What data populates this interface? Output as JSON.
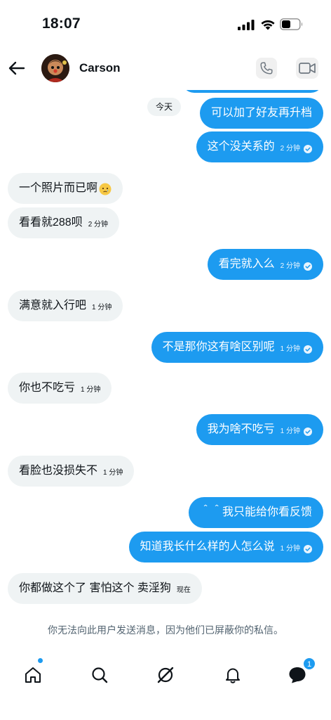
{
  "status_bar": {
    "time": "18:07"
  },
  "header": {
    "contact_name": "Carson"
  },
  "chat": {
    "date_chip": "今天",
    "messages": [
      {
        "dir": "out",
        "text": "可以加了好友再升档",
        "stamp": "",
        "read": false
      },
      {
        "dir": "out",
        "text": "这个没关系的",
        "stamp": "2 分钟",
        "read": true
      },
      {
        "dir": "in",
        "text": "一个照片而已啊",
        "stamp": "",
        "emoji": "crying-face-emoji"
      },
      {
        "dir": "in",
        "text": "看看就288呗",
        "stamp": "2 分钟"
      },
      {
        "dir": "out",
        "text": "看完就入么",
        "stamp": "2 分钟",
        "read": true
      },
      {
        "dir": "in",
        "text": "满意就入行吧",
        "stamp": "1 分钟"
      },
      {
        "dir": "out",
        "text": "不是那你这有啥区别呢",
        "stamp": "1 分钟",
        "read": true
      },
      {
        "dir": "in",
        "text": "你也不吃亏",
        "stamp": "1 分钟"
      },
      {
        "dir": "out",
        "text": "我为啥不吃亏",
        "stamp": "1 分钟",
        "read": true
      },
      {
        "dir": "in",
        "text": "看脸也没损失不",
        "stamp": "1 分钟"
      },
      {
        "dir": "out",
        "text": "＾＾我只能给你看反馈",
        "stamp": "",
        "read": false
      },
      {
        "dir": "out",
        "text": "知道我长什么样的人怎么说",
        "stamp": "1 分钟",
        "read": true
      },
      {
        "dir": "in",
        "text": "你都做这个了 害怕这个 卖淫狗",
        "stamp": "现在"
      }
    ]
  },
  "notice": "你无法向此用户发送消息，因为他们已屏蔽你的私信。",
  "bottom_nav": {
    "items": [
      "home-icon",
      "search-icon",
      "grok-icon",
      "notifications-icon",
      "messages-icon"
    ],
    "messages_badge": "1"
  },
  "colors": {
    "accent": "#1d9bf0",
    "incoming_bubble": "#eff3f4",
    "muted_text": "#536471"
  }
}
